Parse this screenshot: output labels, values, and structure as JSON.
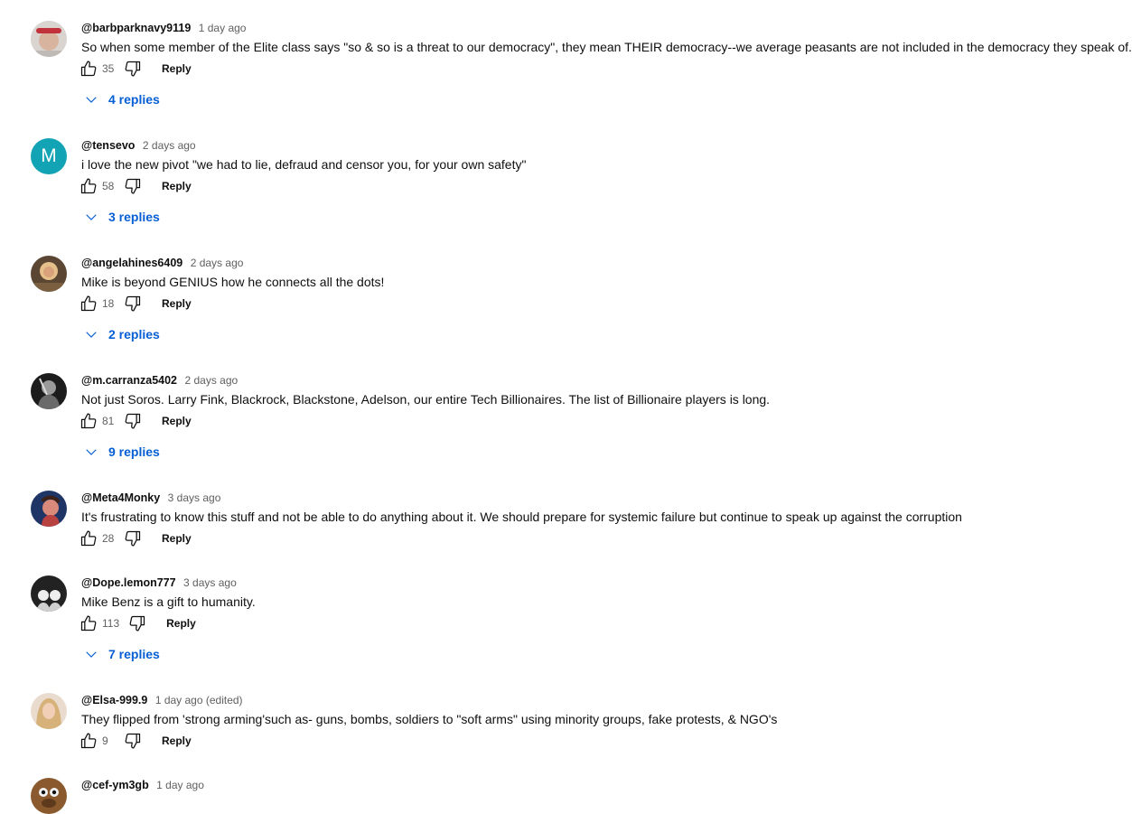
{
  "comments": [
    {
      "author": "@barbparknavy9119",
      "time": "1 day ago",
      "text": "So when some member of the Elite class says \"so & so is a threat to our democracy\", they mean THEIR democracy--we average peasants are not included in the democracy they speak of.",
      "likes": "35",
      "reply_label": "Reply",
      "replies": "4 replies",
      "avatar": "photo-avatar"
    },
    {
      "author": "@tensevo",
      "time": "2 days ago",
      "text": "i love the new pivot \"we had to lie, defraud and censor you, for your own safety\"",
      "likes": "58",
      "reply_label": "Reply",
      "replies": "3 replies",
      "avatar_letter": "M",
      "avatar_color": "#12a3b4"
    },
    {
      "author": "@angelahines6409",
      "time": "2 days ago",
      "text": "Mike is beyond GENIUS how he connects all the dots!",
      "likes": "18",
      "reply_label": "Reply",
      "replies": "2 replies",
      "avatar": "photo-avatar"
    },
    {
      "author": "@m.carranza5402",
      "time": "2 days ago",
      "text": "Not just Soros. Larry Fink, Blackrock, Blackstone, Adelson, our entire Tech Billionaires.  The list of Billionaire players is long.",
      "likes": "81",
      "reply_label": "Reply",
      "replies": "9 replies",
      "avatar": "photo-avatar"
    },
    {
      "author": "@Meta4Monky",
      "time": "3 days ago",
      "text": "It's frustrating to know this stuff and not be able to do anything about it. We should prepare for systemic failure but continue to speak up against the corruption",
      "likes": "28",
      "reply_label": "Reply",
      "avatar": "photo-avatar"
    },
    {
      "author": "@Dope.lemon777",
      "time": "3 days ago",
      "text": "Mike Benz is a gift to humanity.",
      "likes": "113",
      "reply_label": "Reply",
      "replies": "7 replies",
      "avatar": "photo-avatar"
    },
    {
      "author": "@Elsa-999.9",
      "time": "1 day ago (edited)",
      "text": "They flipped from 'strong arming'such as- guns, bombs, soldiers to \"soft arms\" using minority groups, fake protests, & NGO's",
      "likes": "9",
      "reply_label": "Reply",
      "avatar": "photo-avatar"
    },
    {
      "author": "@cef-ym3gb",
      "time": "1 day ago",
      "text": "",
      "avatar": "photo-avatar"
    }
  ],
  "icons": {
    "like": "thumbs-up-icon",
    "dislike": "thumbs-down-icon",
    "expand": "chevron-down-icon"
  },
  "colors": {
    "link_blue": "#065fd4",
    "secondary_text": "#606060"
  }
}
